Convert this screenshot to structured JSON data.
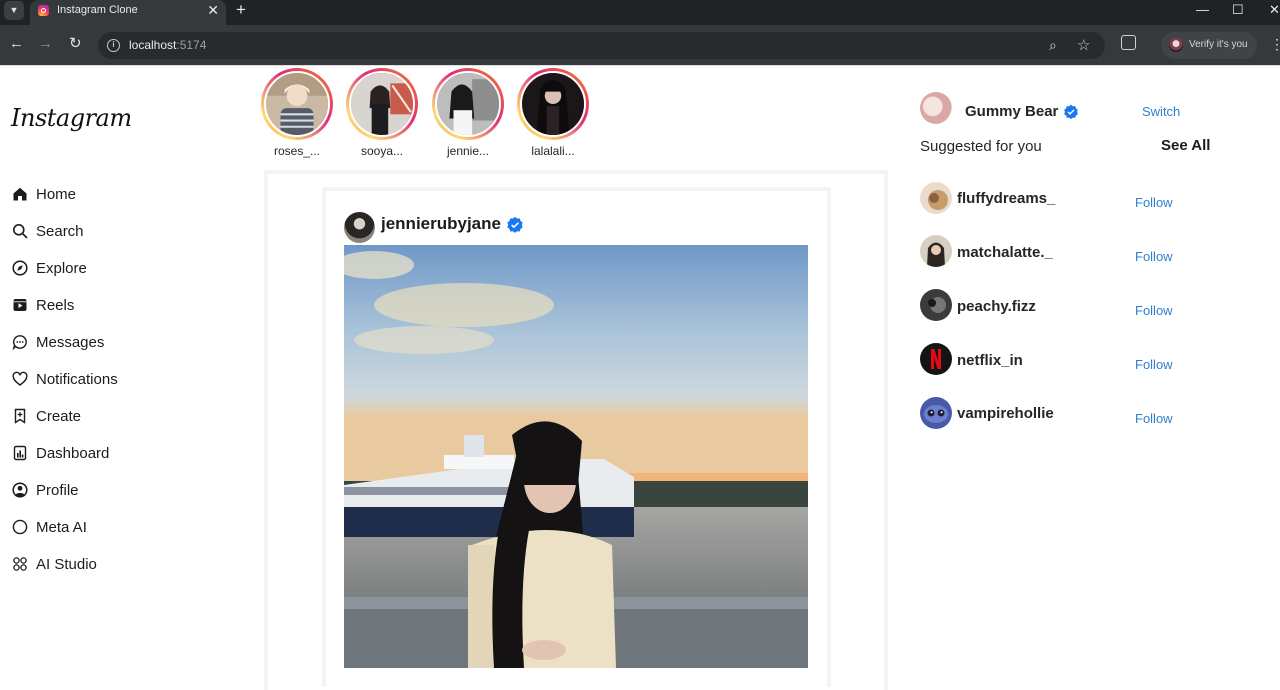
{
  "browser": {
    "tab_title": "Instagram Clone",
    "url_host": "localhost",
    "url_port": ":5174",
    "profile_button": "Verify it's you"
  },
  "app": {
    "logo": "Instagram"
  },
  "sidebar": {
    "items": [
      {
        "label": "Home",
        "icon": "home-icon"
      },
      {
        "label": "Search",
        "icon": "search-icon"
      },
      {
        "label": "Explore",
        "icon": "compass-icon"
      },
      {
        "label": "Reels",
        "icon": "reels-icon"
      },
      {
        "label": "Messages",
        "icon": "message-icon"
      },
      {
        "label": "Notifications",
        "icon": "heart-icon"
      },
      {
        "label": "Create",
        "icon": "create-icon"
      },
      {
        "label": "Dashboard",
        "icon": "dashboard-icon"
      },
      {
        "label": "Profile",
        "icon": "profile-icon"
      },
      {
        "label": "Meta AI",
        "icon": "meta-ai-icon"
      },
      {
        "label": "AI Studio",
        "icon": "ai-studio-icon"
      }
    ]
  },
  "stories": [
    {
      "label": "roses_..."
    },
    {
      "label": "sooya..."
    },
    {
      "label": "jennie..."
    },
    {
      "label": "lalalali..."
    }
  ],
  "post": {
    "username": "jennierubyjane",
    "verified": true
  },
  "right": {
    "current_user": "Gummy Bear",
    "current_user_verified": true,
    "switch_label": "Switch",
    "suggested_title": "Suggested for you",
    "see_all_label": "See All",
    "suggestions": [
      {
        "username": "fluffydreams_",
        "action": "Follow"
      },
      {
        "username": "matchalatte._",
        "action": "Follow"
      },
      {
        "username": "peachy.fizz",
        "action": "Follow"
      },
      {
        "username": "netflix_in",
        "action": "Follow"
      },
      {
        "username": "vampirehollie",
        "action": "Follow"
      }
    ]
  },
  "colors": {
    "link_blue": "#2f7fcf",
    "verified_blue": "#1877f2",
    "chrome_dark": "#35393c"
  }
}
